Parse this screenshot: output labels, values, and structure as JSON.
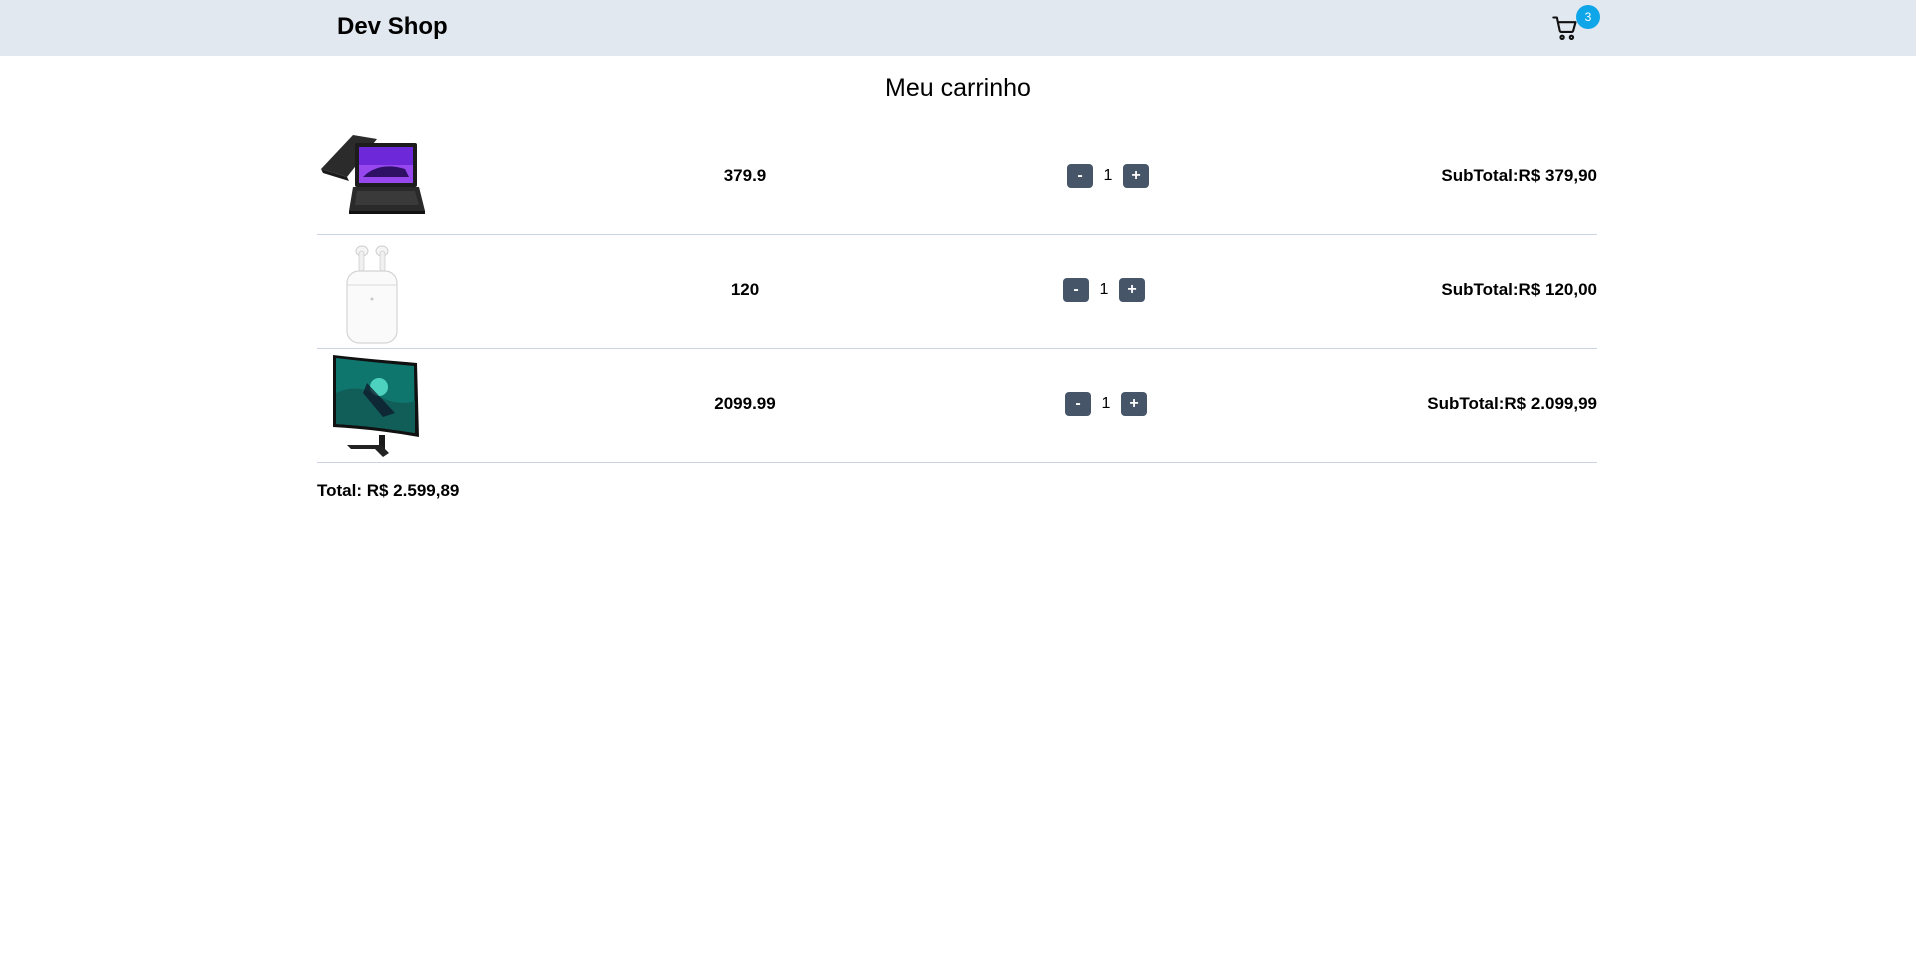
{
  "header": {
    "brand": "Dev Shop",
    "cart_count": "3"
  },
  "page_title": "Meu carrinho",
  "items": [
    {
      "image": "laptop",
      "price": "379.9",
      "quantity": "1",
      "subtotal": "SubTotal:R$ 379,90"
    },
    {
      "image": "airpods",
      "price": "120",
      "quantity": "1",
      "subtotal": "SubTotal:R$ 120,00"
    },
    {
      "image": "curved-monitor",
      "price": "2099.99",
      "quantity": "1",
      "subtotal": "SubTotal:R$ 2.099,99"
    }
  ],
  "controls": {
    "decrease_label": "-",
    "increase_label": "+"
  },
  "total": "Total: R$ 2.599,89",
  "colors": {
    "header_bg": "#e2e8f0",
    "badge": "#0ea5e9",
    "qty_button": "#475569",
    "divider": "#cbd5e1"
  }
}
